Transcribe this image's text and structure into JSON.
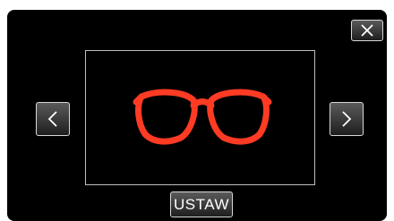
{
  "header": {
    "close_icon": "close-icon"
  },
  "navigation": {
    "prev_icon": "chevron-left-icon",
    "next_icon": "chevron-right-icon"
  },
  "preview": {
    "item_icon": "glasses-icon",
    "item_color": "#ff3b24"
  },
  "footer": {
    "set_label": "USTAW"
  }
}
